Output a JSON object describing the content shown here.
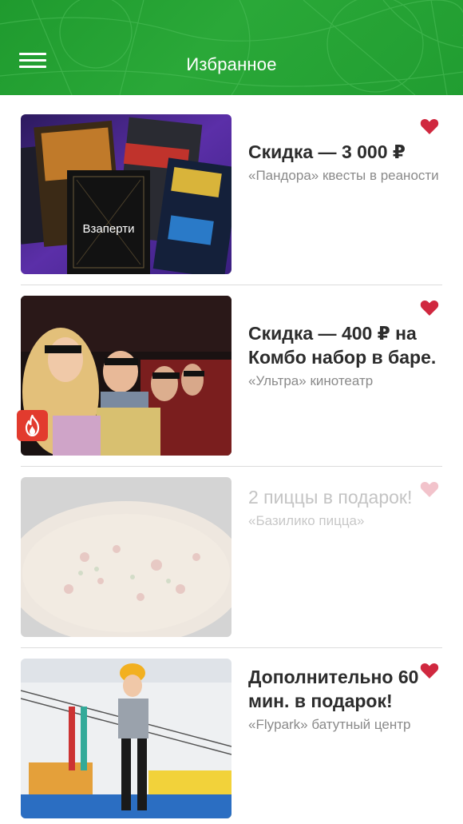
{
  "header": {
    "title": "Избранное",
    "menu_icon": "hamburger-menu-icon",
    "background_color": "#2aa838"
  },
  "favorites": [
    {
      "offer": "Скидка — 3 000 ₽",
      "place": "«Пандора» квесты в реаности",
      "image_text": "Взаперти",
      "liked": true,
      "active": true
    },
    {
      "offer": "Скидка — 400 ₽ на Комбо набор в баре.",
      "place": "«Ультра» кинотеатр",
      "liked": true,
      "active": true,
      "hot_badge_icon": "flame-icon"
    },
    {
      "offer": "2 пиццы в подарок!",
      "place": "«Базилико пицца»",
      "liked": true,
      "active": false
    },
    {
      "offer": "Дополнительно 60 мин. в подарок!",
      "place": "«Flypark» батутный центр",
      "liked": true,
      "active": true
    }
  ],
  "colors": {
    "heart_active": "#d0283f",
    "heart_inactive": "#f2c3cb",
    "hot_badge": "#e23b2e"
  }
}
